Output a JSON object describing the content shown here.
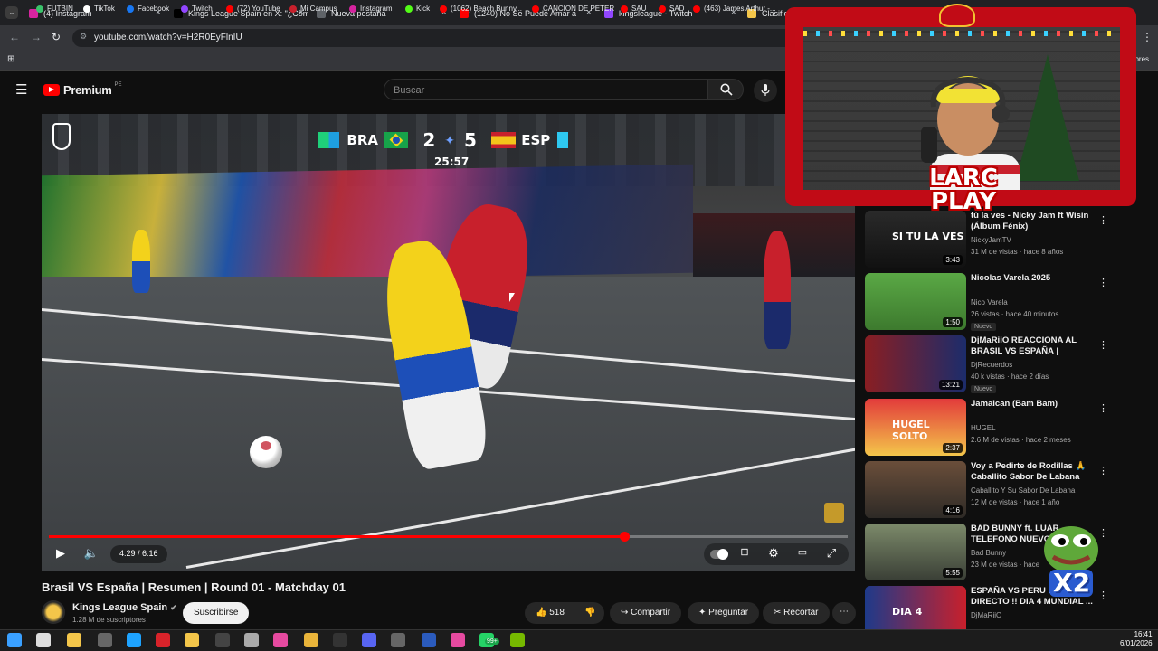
{
  "browser": {
    "tabs": [
      {
        "title": "(4) Instagram",
        "color": "#d6249f"
      },
      {
        "title": "Kings League Spain en X: \"¿Cóm",
        "color": "#000000"
      },
      {
        "title": "Nueva pestaña",
        "color": "#5f6368"
      },
      {
        "title": "(1240) No Se Puede Amar a",
        "color": "#ff0000"
      },
      {
        "title": "kingsleague - Twitch",
        "color": "#9146ff"
      },
      {
        "title": "Clasificac",
        "color": "#f4c64a"
      }
    ],
    "url": "youtube.com/watch?v=H2R0EyFlnIU",
    "bookmarks": [
      "FUTBIN",
      "TikTok",
      "Facebook",
      "Twitch",
      "(72) YouTube",
      "Mi Campus",
      "Instagram",
      "Kick",
      "(1062) Beach Bunny...",
      "CANCION DE PETER",
      "SAU",
      "SAD",
      "(463) James Arthur -..."
    ],
    "bookmarks_right": "dores"
  },
  "youtube": {
    "logo": "Premium",
    "region": "PE",
    "search_placeholder": "Buscar"
  },
  "video": {
    "score": {
      "team1": "BRA",
      "score1": "2",
      "score2": "5",
      "team2": "ESP",
      "clock": "25:57"
    },
    "time": "4:29 / 6:16",
    "progress": 0.72,
    "title": "Brasil VS España | Resumen | Round 01 - Matchday 01",
    "channel": "Kings League Spain",
    "subscribers": "1.28 M de suscriptores",
    "subscribe_label": "Suscribirse",
    "likes": "518",
    "share_label": "Compartir",
    "ask_label": "Preguntar",
    "clip_label": "Recortar"
  },
  "recommendations": [
    {
      "title": "tú la ves - Nicky Jam ft Wisin (Álbum Fénix)",
      "channel": "NickyJamTV",
      "views": "31 M de vistas · hace 8 años",
      "duration": "3:43",
      "thumb_text": "SI TU LA VES",
      "badge": ""
    },
    {
      "title": "Nicolas Varela 2025",
      "channel": "Nico Varela",
      "views": "26 vistas · hace 40 minutos",
      "duration": "1:50",
      "thumb_text": "",
      "badge": "Nuevo"
    },
    {
      "title": "DjMaRiiO REACCIONA AL BRASIL VS ESPAÑA | MUNDIA...",
      "channel": "DjRecuerdos",
      "views": "40 k vistas · hace 2 días",
      "duration": "13:21",
      "thumb_text": "",
      "badge": "Nuevo"
    },
    {
      "title": "Jamaican (Bam Bam)",
      "channel": "HUGEL",
      "views": "2.6 M de vistas · hace 2 meses",
      "duration": "2:37",
      "thumb_text": "HUGEL SOLTO",
      "badge": ""
    },
    {
      "title": "Voy a Pedirte de Rodillas 🙏 Caballito Sabor De Labana",
      "channel": "Caballito Y Su Sabor De Labana",
      "views": "12 M de vistas · hace 1 año",
      "duration": "4:16",
      "thumb_text": "",
      "badge": ""
    },
    {
      "title": "BAD BUNNY ft. LUAR TELEFONO NUEVO",
      "channel": "Bad Bunny",
      "views": "23 M de vistas · hace",
      "duration": "5:55",
      "thumb_text": "",
      "badge": ""
    },
    {
      "title": "ESPAÑA VS PERU E... DIRECTO !! DIA 4 MUNDIAL ...",
      "channel": "DjMaRiiO",
      "views": "",
      "duration": "",
      "thumb_text": "DIA 4",
      "badge": ""
    }
  ],
  "overlay": {
    "logo_line1": "LARC",
    "logo_line2": "PLAY",
    "sticker_text": "X2"
  },
  "taskbar": {
    "time": "16:41",
    "date": "6/01/2026",
    "badge": "99+"
  }
}
